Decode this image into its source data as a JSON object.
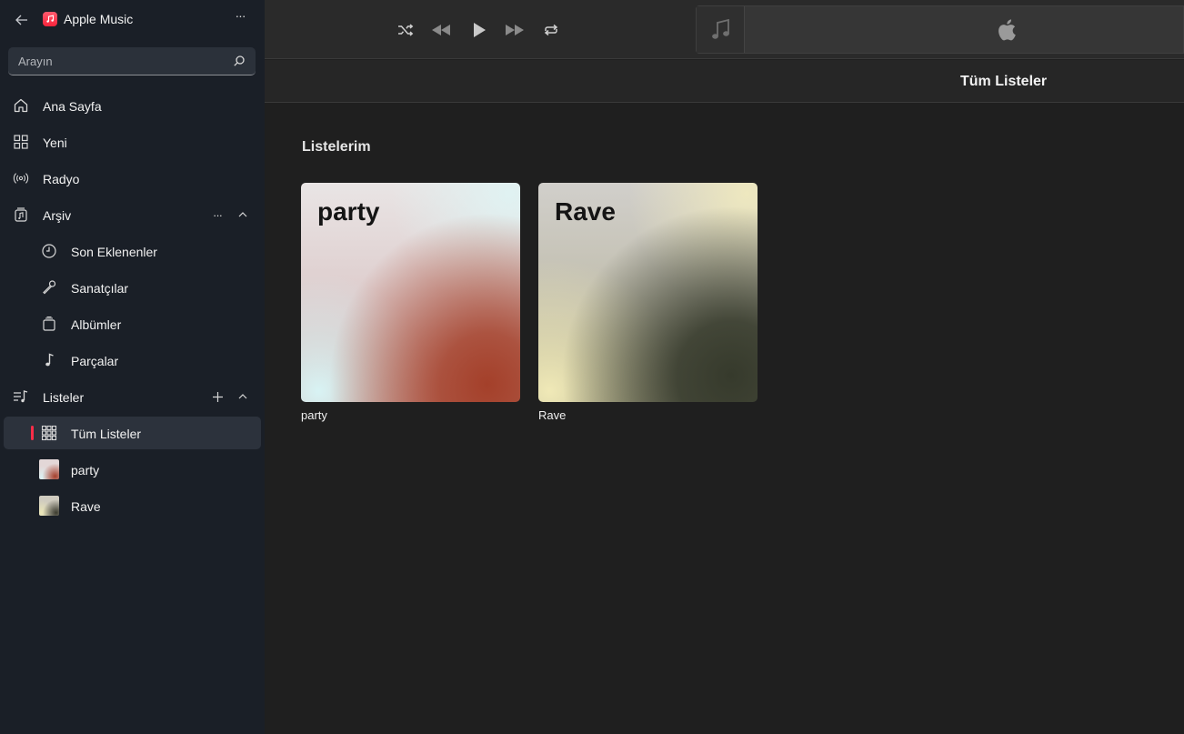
{
  "app": {
    "title": "Apple Music"
  },
  "search": {
    "placeholder": "Arayın"
  },
  "sidebar": {
    "nav": [
      {
        "label": "Ana Sayfa",
        "icon": "home-icon"
      },
      {
        "label": "Yeni",
        "icon": "grid-icon"
      },
      {
        "label": "Radyo",
        "icon": "radio-icon"
      }
    ],
    "library": {
      "label": "Arşiv",
      "items": [
        {
          "label": "Son Eklenenler",
          "icon": "clock-icon"
        },
        {
          "label": "Sanatçılar",
          "icon": "microphone-icon"
        },
        {
          "label": "Albümler",
          "icon": "album-stack-icon"
        },
        {
          "label": "Parçalar",
          "icon": "music-note-icon"
        }
      ]
    },
    "playlists": {
      "label": "Listeler",
      "items": [
        {
          "label": "Tüm Listeler",
          "icon": "grid-9-icon",
          "active": true
        },
        {
          "label": "party",
          "icon": "playlist-thumbnail"
        },
        {
          "label": "Rave",
          "icon": "playlist-thumbnail"
        }
      ]
    }
  },
  "player": {
    "controls": [
      "shuffle",
      "previous",
      "play",
      "next",
      "repeat"
    ]
  },
  "content": {
    "title": "Tüm Listeler",
    "section_title": "Listelerim",
    "playlists": [
      {
        "art_title": "party",
        "label": "party"
      },
      {
        "art_title": "Rave",
        "label": "Rave"
      }
    ]
  },
  "colors": {
    "accent": "#fa2d48",
    "sidebar_bg": "#1a1f27",
    "main_bg": "#1f1f1f"
  }
}
